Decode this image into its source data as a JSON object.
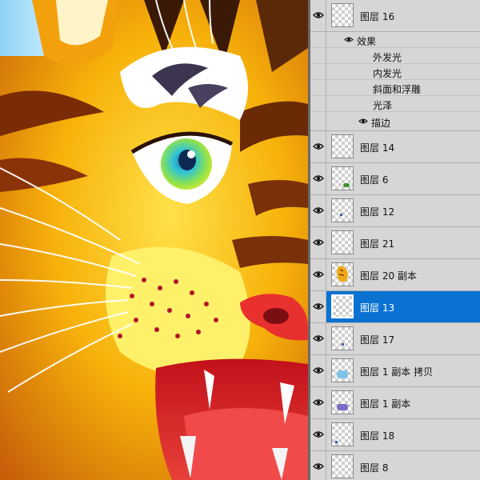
{
  "layers": [
    {
      "name": "图层 16",
      "visible": true,
      "thumb": "blank"
    },
    {
      "name": "图层 14",
      "visible": true,
      "thumb": "blank"
    },
    {
      "name": "图层 6",
      "visible": true,
      "thumb": "leaf"
    },
    {
      "name": "图层 12",
      "visible": true,
      "thumb": "dots"
    },
    {
      "name": "图层 21",
      "visible": true,
      "thumb": "blank"
    },
    {
      "name": "图层 20 副本",
      "visible": true,
      "thumb": "tiger"
    },
    {
      "name": "图层 13",
      "visible": true,
      "thumb": "blank",
      "selected": true
    },
    {
      "name": "图层 17",
      "visible": true,
      "thumb": "dots"
    },
    {
      "name": "图层 1 副本 拷贝",
      "visible": true,
      "thumb": "blue"
    },
    {
      "name": "图层 1 副本",
      "visible": true,
      "thumb": "purple"
    },
    {
      "name": "图层 18",
      "visible": true,
      "thumb": "dots"
    },
    {
      "name": "图层 8",
      "visible": true,
      "thumb": "blank"
    }
  ],
  "effects": {
    "title": "效果",
    "items": [
      "外发光",
      "内发光",
      "斜面和浮雕",
      "光泽"
    ],
    "stroke": "描边"
  },
  "colors": {
    "selected_row": "#0a72d1",
    "panel_bg": "#d6d6d6"
  },
  "artwork": {
    "subject": "tiger-face"
  }
}
